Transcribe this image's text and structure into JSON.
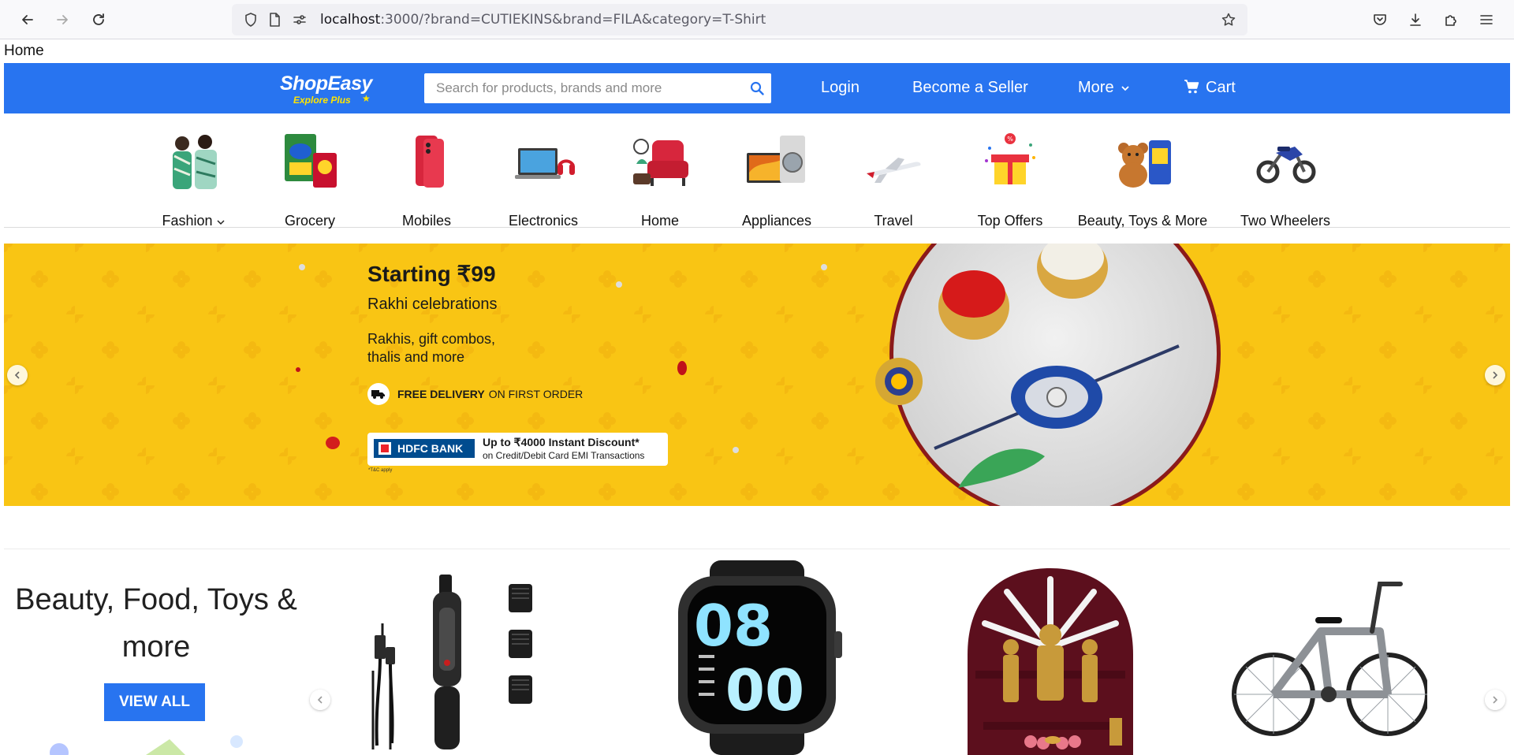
{
  "browser": {
    "url_host": "localhost",
    "url_rest": ":3000/?brand=CUTIEKINS&brand=FILA&category=T-Shirt"
  },
  "breadcrumb": "Home",
  "header": {
    "logo_main": "ShopEasy",
    "logo_sub": "Explore Plus",
    "search_placeholder": "Search for products, brands and more",
    "login": "Login",
    "seller": "Become a Seller",
    "more": "More",
    "cart": "Cart",
    "brand_color": "#2874f0",
    "accent_color": "#ffe500"
  },
  "categories": [
    {
      "label": "Fashion",
      "icon": "fashion-icon",
      "has_dropdown": true
    },
    {
      "label": "Grocery",
      "icon": "grocery-icon"
    },
    {
      "label": "Mobiles",
      "icon": "mobiles-icon"
    },
    {
      "label": "Electronics",
      "icon": "electronics-icon"
    },
    {
      "label": "Home",
      "icon": "home-furniture-icon"
    },
    {
      "label": "Appliances",
      "icon": "appliances-icon"
    },
    {
      "label": "Travel",
      "icon": "travel-icon"
    },
    {
      "label": "Top Offers",
      "icon": "top-offers-icon"
    },
    {
      "label": "Beauty, Toys & More",
      "icon": "beauty-toys-icon"
    },
    {
      "label": "Two Wheelers",
      "icon": "two-wheelers-icon"
    }
  ],
  "banner": {
    "title": "Starting ₹99",
    "subtitle": "Rakhi celebrations",
    "desc_line1": "Rakhis, gift combos,",
    "desc_line2": "thalis and more",
    "delivery_bold": "FREE DELIVERY",
    "delivery_rest": "ON FIRST ORDER",
    "bank_name": "HDFC BANK",
    "bank_offer": "Up to ₹4000 Instant Discount*",
    "bank_terms": "on Credit/Debit Card EMI Transactions",
    "tc": "*T&C apply",
    "bg_color": "#f8c613"
  },
  "deals": {
    "title": "Beauty, Food, Toys & more",
    "view_all": "VIEW ALL",
    "products": [
      "trimmer-image",
      "smartwatch-image",
      "temple-image",
      "bicycle-image"
    ],
    "watch_hours": "08",
    "watch_minutes": "00"
  }
}
